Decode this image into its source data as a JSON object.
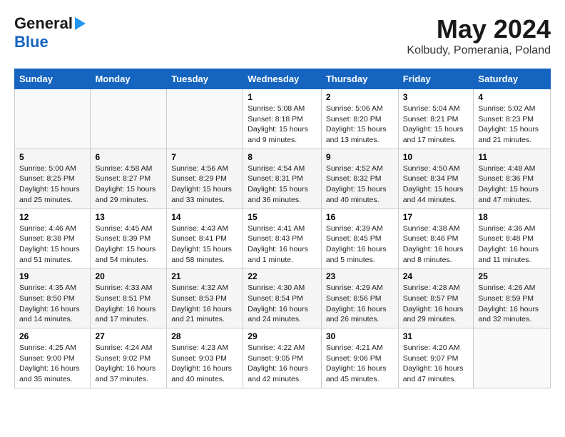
{
  "header": {
    "logo_line1": "General",
    "logo_line2": "Blue",
    "title": "May 2024",
    "subtitle": "Kolbudy, Pomerania, Poland"
  },
  "days_of_week": [
    "Sunday",
    "Monday",
    "Tuesday",
    "Wednesday",
    "Thursday",
    "Friday",
    "Saturday"
  ],
  "weeks": [
    [
      {
        "day": "",
        "info": ""
      },
      {
        "day": "",
        "info": ""
      },
      {
        "day": "",
        "info": ""
      },
      {
        "day": "1",
        "info": "Sunrise: 5:08 AM\nSunset: 8:18 PM\nDaylight: 15 hours and 9 minutes."
      },
      {
        "day": "2",
        "info": "Sunrise: 5:06 AM\nSunset: 8:20 PM\nDaylight: 15 hours and 13 minutes."
      },
      {
        "day": "3",
        "info": "Sunrise: 5:04 AM\nSunset: 8:21 PM\nDaylight: 15 hours and 17 minutes."
      },
      {
        "day": "4",
        "info": "Sunrise: 5:02 AM\nSunset: 8:23 PM\nDaylight: 15 hours and 21 minutes."
      }
    ],
    [
      {
        "day": "5",
        "info": "Sunrise: 5:00 AM\nSunset: 8:25 PM\nDaylight: 15 hours and 25 minutes."
      },
      {
        "day": "6",
        "info": "Sunrise: 4:58 AM\nSunset: 8:27 PM\nDaylight: 15 hours and 29 minutes."
      },
      {
        "day": "7",
        "info": "Sunrise: 4:56 AM\nSunset: 8:29 PM\nDaylight: 15 hours and 33 minutes."
      },
      {
        "day": "8",
        "info": "Sunrise: 4:54 AM\nSunset: 8:31 PM\nDaylight: 15 hours and 36 minutes."
      },
      {
        "day": "9",
        "info": "Sunrise: 4:52 AM\nSunset: 8:32 PM\nDaylight: 15 hours and 40 minutes."
      },
      {
        "day": "10",
        "info": "Sunrise: 4:50 AM\nSunset: 8:34 PM\nDaylight: 15 hours and 44 minutes."
      },
      {
        "day": "11",
        "info": "Sunrise: 4:48 AM\nSunset: 8:36 PM\nDaylight: 15 hours and 47 minutes."
      }
    ],
    [
      {
        "day": "12",
        "info": "Sunrise: 4:46 AM\nSunset: 8:38 PM\nDaylight: 15 hours and 51 minutes."
      },
      {
        "day": "13",
        "info": "Sunrise: 4:45 AM\nSunset: 8:39 PM\nDaylight: 15 hours and 54 minutes."
      },
      {
        "day": "14",
        "info": "Sunrise: 4:43 AM\nSunset: 8:41 PM\nDaylight: 15 hours and 58 minutes."
      },
      {
        "day": "15",
        "info": "Sunrise: 4:41 AM\nSunset: 8:43 PM\nDaylight: 16 hours and 1 minute."
      },
      {
        "day": "16",
        "info": "Sunrise: 4:39 AM\nSunset: 8:45 PM\nDaylight: 16 hours and 5 minutes."
      },
      {
        "day": "17",
        "info": "Sunrise: 4:38 AM\nSunset: 8:46 PM\nDaylight: 16 hours and 8 minutes."
      },
      {
        "day": "18",
        "info": "Sunrise: 4:36 AM\nSunset: 8:48 PM\nDaylight: 16 hours and 11 minutes."
      }
    ],
    [
      {
        "day": "19",
        "info": "Sunrise: 4:35 AM\nSunset: 8:50 PM\nDaylight: 16 hours and 14 minutes."
      },
      {
        "day": "20",
        "info": "Sunrise: 4:33 AM\nSunset: 8:51 PM\nDaylight: 16 hours and 17 minutes."
      },
      {
        "day": "21",
        "info": "Sunrise: 4:32 AM\nSunset: 8:53 PM\nDaylight: 16 hours and 21 minutes."
      },
      {
        "day": "22",
        "info": "Sunrise: 4:30 AM\nSunset: 8:54 PM\nDaylight: 16 hours and 24 minutes."
      },
      {
        "day": "23",
        "info": "Sunrise: 4:29 AM\nSunset: 8:56 PM\nDaylight: 16 hours and 26 minutes."
      },
      {
        "day": "24",
        "info": "Sunrise: 4:28 AM\nSunset: 8:57 PM\nDaylight: 16 hours and 29 minutes."
      },
      {
        "day": "25",
        "info": "Sunrise: 4:26 AM\nSunset: 8:59 PM\nDaylight: 16 hours and 32 minutes."
      }
    ],
    [
      {
        "day": "26",
        "info": "Sunrise: 4:25 AM\nSunset: 9:00 PM\nDaylight: 16 hours and 35 minutes."
      },
      {
        "day": "27",
        "info": "Sunrise: 4:24 AM\nSunset: 9:02 PM\nDaylight: 16 hours and 37 minutes."
      },
      {
        "day": "28",
        "info": "Sunrise: 4:23 AM\nSunset: 9:03 PM\nDaylight: 16 hours and 40 minutes."
      },
      {
        "day": "29",
        "info": "Sunrise: 4:22 AM\nSunset: 9:05 PM\nDaylight: 16 hours and 42 minutes."
      },
      {
        "day": "30",
        "info": "Sunrise: 4:21 AM\nSunset: 9:06 PM\nDaylight: 16 hours and 45 minutes."
      },
      {
        "day": "31",
        "info": "Sunrise: 4:20 AM\nSunset: 9:07 PM\nDaylight: 16 hours and 47 minutes."
      },
      {
        "day": "",
        "info": ""
      }
    ]
  ]
}
